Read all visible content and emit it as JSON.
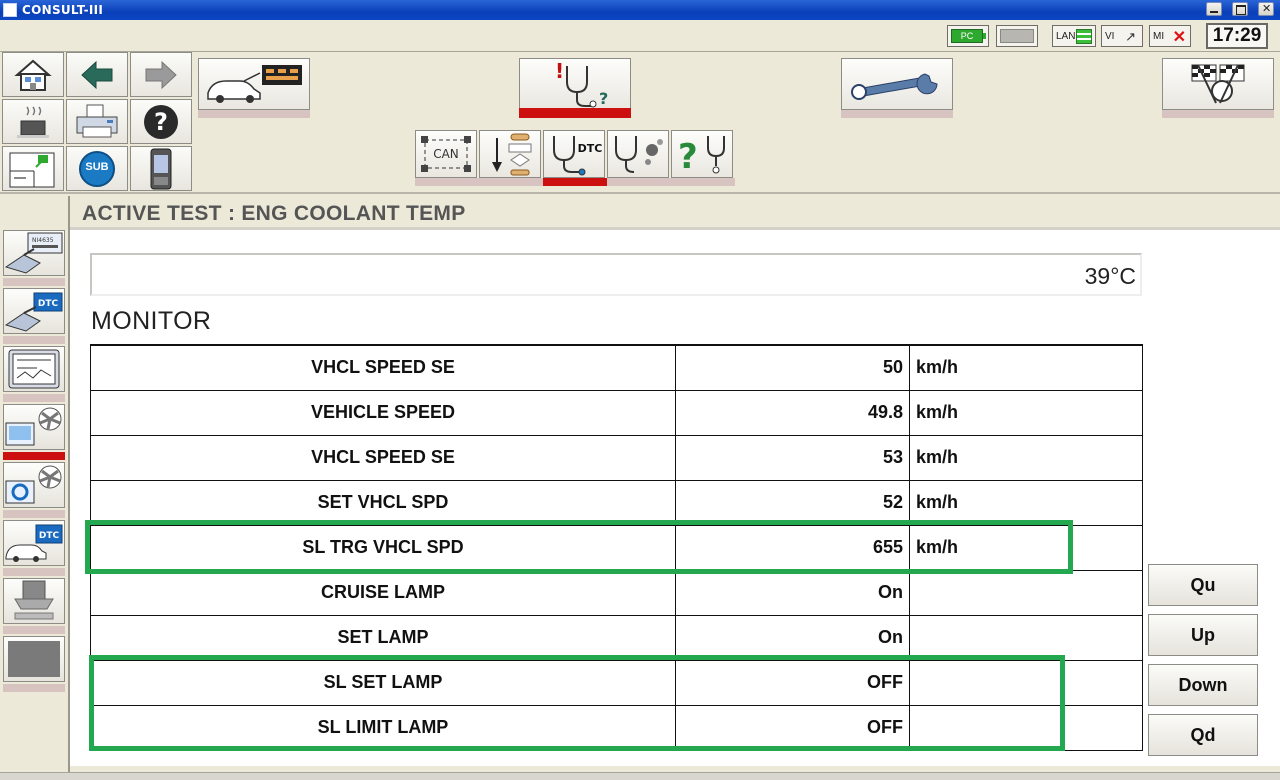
{
  "window": {
    "title": "CONSULT-III"
  },
  "status": {
    "pc_label": "PC",
    "lan_label": "LAN",
    "vi_label": "VI",
    "mi_label": "MI",
    "clock": "17:29"
  },
  "toolbar": {
    "sub_label": "SUB",
    "can_label": "CAN",
    "dtc_label": "DTC"
  },
  "sidebar": {
    "dtc_label": "DTC",
    "nissan_label": "NI4635"
  },
  "main": {
    "title": "ACTIVE TEST : ENG COOLANT TEMP",
    "value": "39°C",
    "monitor_label": "MONITOR",
    "rows": [
      {
        "name": "VHCL SPEED SE",
        "value": "50",
        "unit": "km/h"
      },
      {
        "name": "VEHICLE SPEED",
        "value": "49.8",
        "unit": "km/h"
      },
      {
        "name": "VHCL SPEED SE",
        "value": "53",
        "unit": "km/h"
      },
      {
        "name": "SET VHCL SPD",
        "value": "52",
        "unit": "km/h"
      },
      {
        "name": "SL TRG VHCL SPD",
        "value": "655",
        "unit": "km/h"
      },
      {
        "name": "CRUISE LAMP",
        "value": "On",
        "unit": ""
      },
      {
        "name": "SET LAMP",
        "value": "On",
        "unit": ""
      },
      {
        "name": "SL SET LAMP",
        "value": "OFF",
        "unit": ""
      },
      {
        "name": "SL LIMIT LAMP",
        "value": "OFF",
        "unit": ""
      }
    ],
    "actions": {
      "qu": "Qu",
      "up": "Up",
      "down": "Down",
      "qd": "Qd"
    }
  },
  "colors": {
    "highlight": "#23a84f",
    "active_underline": "#cc1010",
    "titlebar": "#0a3fb8"
  }
}
